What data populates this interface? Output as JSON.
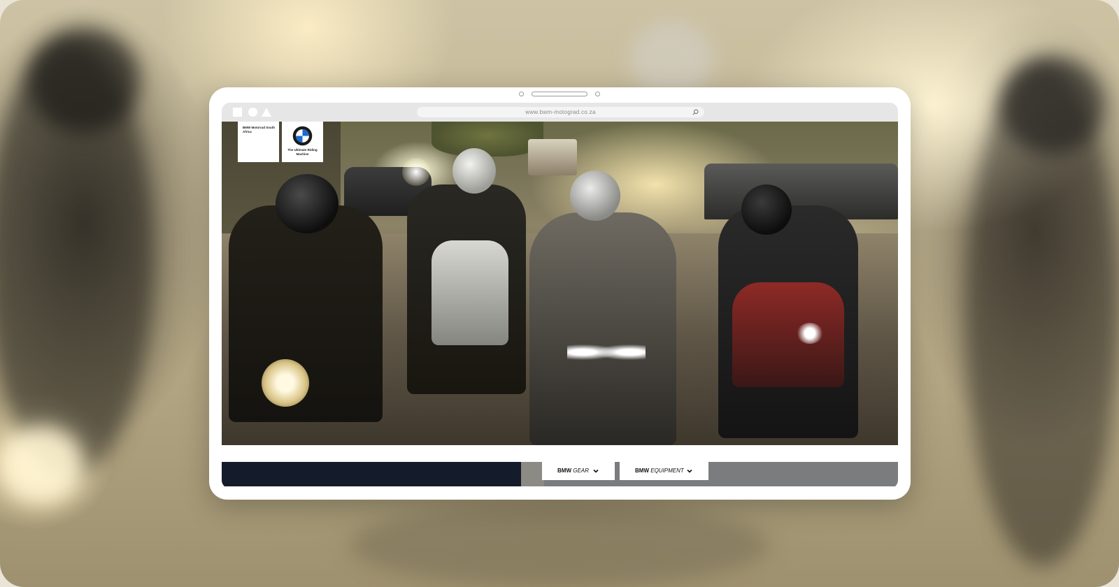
{
  "browser": {
    "url": "www.bwm-motograd.co.za",
    "window_controls": [
      "square-icon",
      "circle-icon",
      "triangle-icon"
    ]
  },
  "header": {
    "logo_left_text": "BMW Motorrad South Africa",
    "roundel_icon": "bmw-roundel-icon",
    "tagline": "The Ultimate Riding Machine"
  },
  "hero": {
    "image_description_icon": "riders-photo-icon"
  },
  "nav": {
    "gear_brand": "BMW",
    "gear_label": "GEAR",
    "equipment_brand": "BMW",
    "equipment_label": "EQUIPMENT",
    "dropdown_icon": "chevron-down-icon"
  },
  "colors": {
    "strip_dark": "#141b2b",
    "strip_grey": "#7b7c7e",
    "frame": "#ffffff",
    "chrome": "#e6e6e6"
  }
}
